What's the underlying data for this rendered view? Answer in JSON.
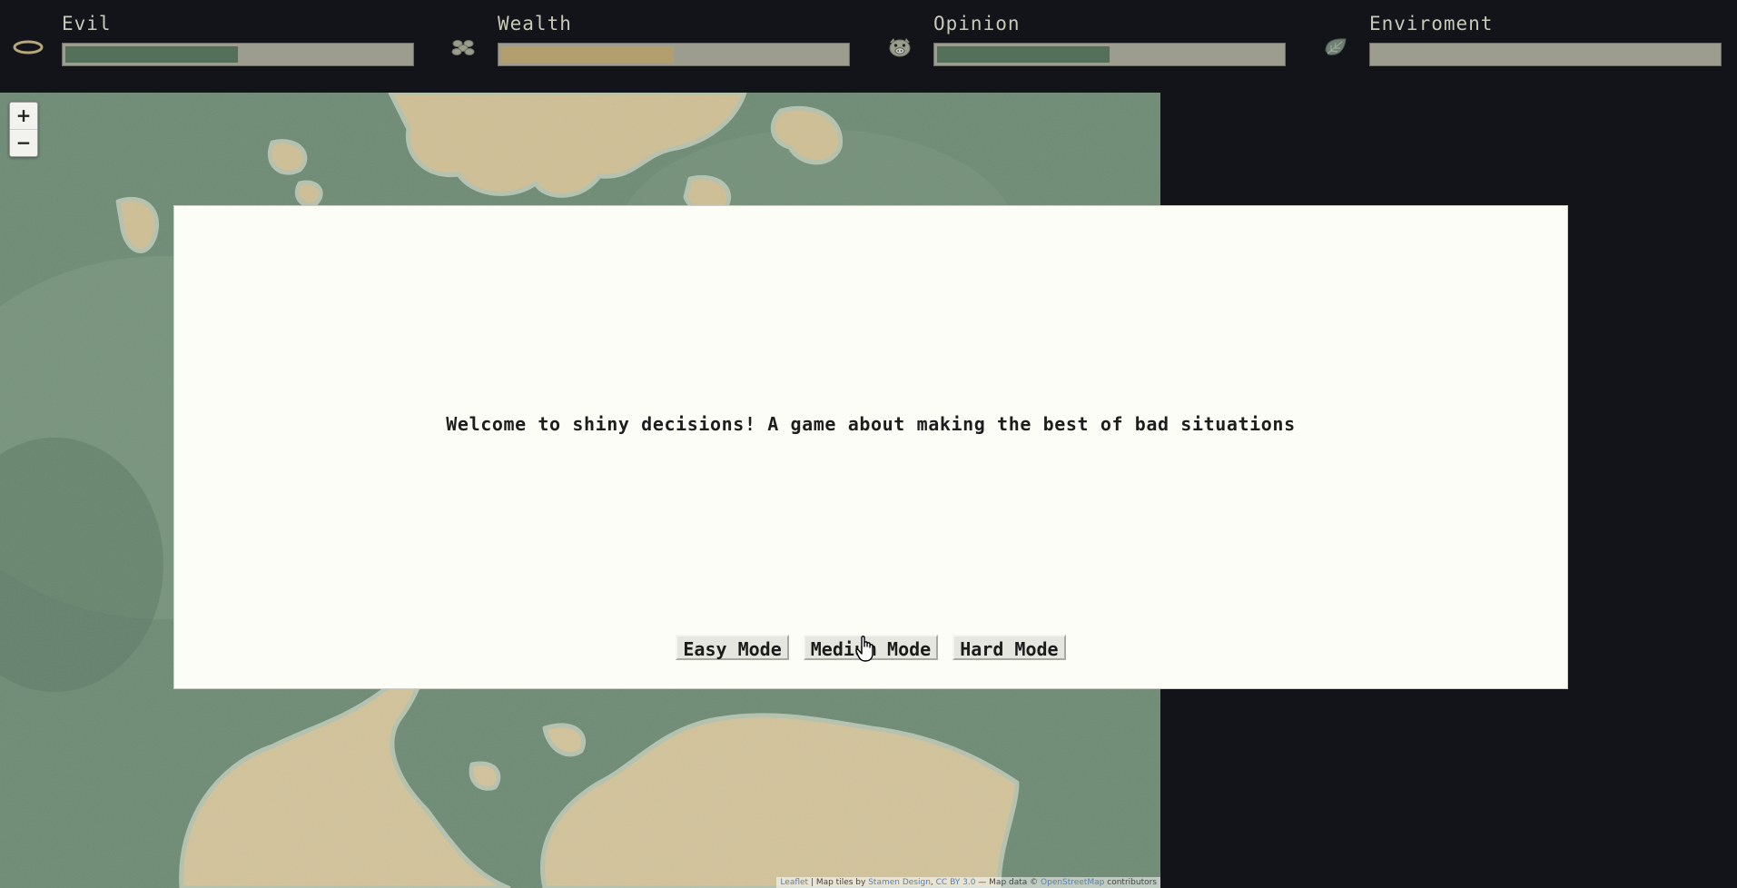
{
  "stats": [
    {
      "label": "Evil",
      "icon": "halo-icon",
      "value_percent": 50,
      "fill_color": "#55705a"
    },
    {
      "label": "Wealth",
      "icon": "coins-icon",
      "value_percent": 50,
      "fill_color": "#b39e6f"
    },
    {
      "label": "Opinion",
      "icon": "pig-face-icon",
      "value_percent": 50,
      "fill_color": "#55705a"
    },
    {
      "label": "Enviroment",
      "icon": "leaf-icon",
      "value_percent": 0,
      "fill_color": "#55705a"
    }
  ],
  "map": {
    "zoom_in_label": "+",
    "zoom_out_label": "−",
    "attribution": {
      "leaflet": "Leaflet",
      "sep1": " | Map tiles by ",
      "stamen": "Stamen Design",
      "sep2": ", ",
      "license": "CC BY 3.0",
      "sep3": " — Map data © ",
      "osm": "OpenStreetMap",
      "tail": " contributors"
    }
  },
  "modal": {
    "message": "Welcome to shiny decisions! A game about making the best of bad situations",
    "buttons": {
      "easy": "Easy Mode",
      "medium": "Medium Mode",
      "hard": "Hard Mode"
    }
  }
}
